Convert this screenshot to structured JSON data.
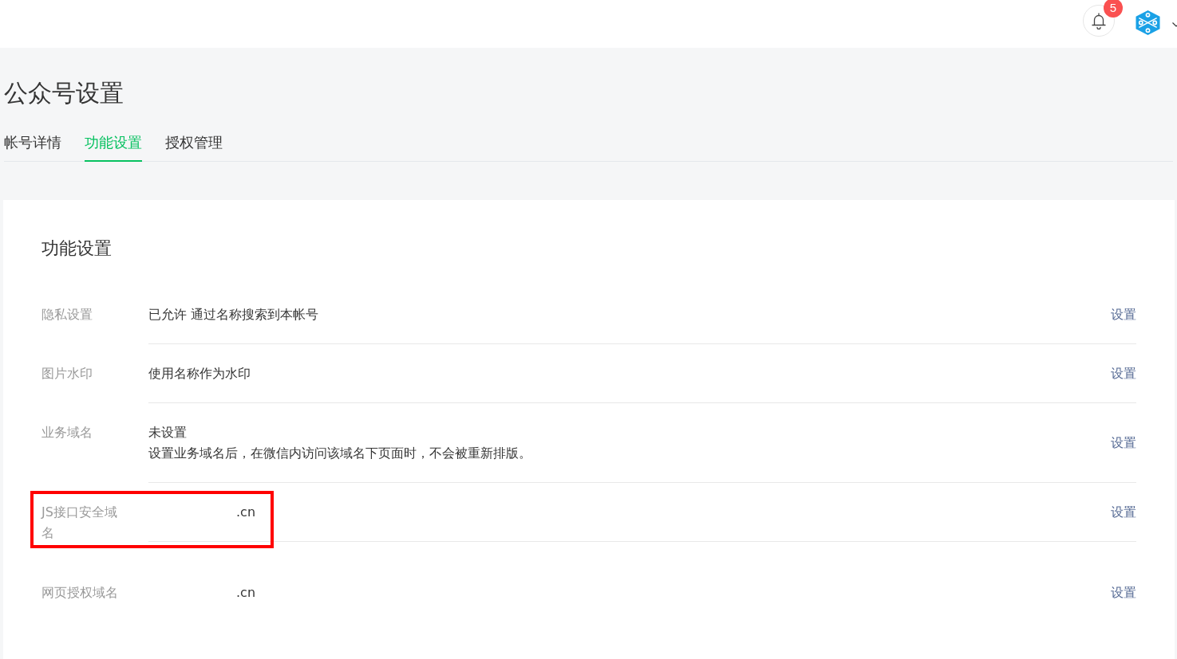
{
  "header": {
    "notifications": {
      "count": "5"
    }
  },
  "page": {
    "title": "公众号设置"
  },
  "tabs": [
    {
      "label": "帐号详情",
      "selected": false
    },
    {
      "label": "功能设置",
      "selected": true
    },
    {
      "label": "授权管理",
      "selected": false
    }
  ],
  "card": {
    "title": "功能设置",
    "rows": [
      {
        "label": "隐私设置",
        "lines": [
          "已允许 通过名称搜索到本帐号"
        ],
        "action": "设置",
        "highlighted": false,
        "redacted": false
      },
      {
        "label": "图片水印",
        "lines": [
          "使用名称作为水印"
        ],
        "action": "设置",
        "highlighted": false,
        "redacted": false
      },
      {
        "label": "业务域名",
        "lines": [
          "未设置",
          "设置业务域名后，在微信内访问该域名下页面时，不会被重新排版。"
        ],
        "action": "设置",
        "highlighted": false,
        "redacted": false
      },
      {
        "label": "JS接口安全域名",
        "lines": [
          ".cn"
        ],
        "action": "设置",
        "highlighted": true,
        "redacted": true
      },
      {
        "label": "网页授权域名",
        "lines": [
          ".cn"
        ],
        "action": "设置",
        "highlighted": false,
        "redacted": true
      }
    ]
  }
}
